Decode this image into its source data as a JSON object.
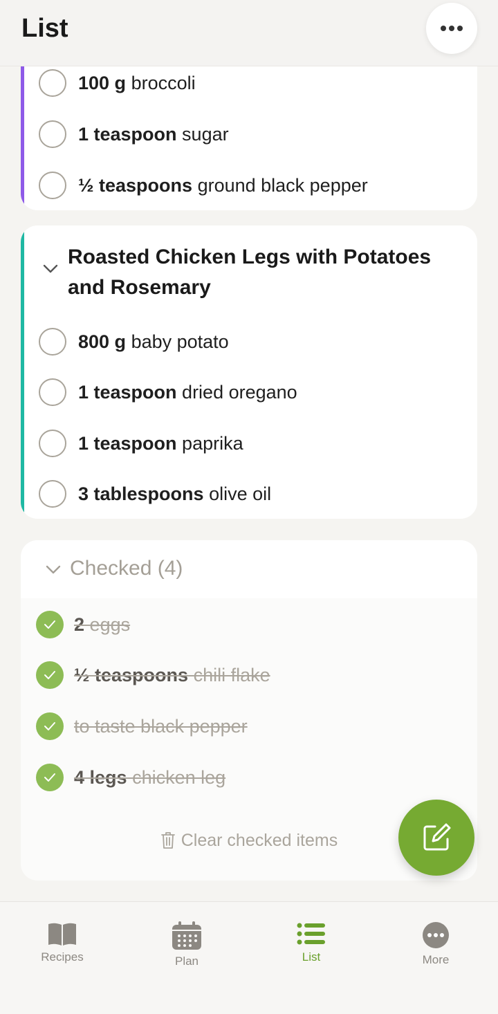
{
  "header": {
    "title": "List",
    "more_icon": "ellipsis-icon"
  },
  "card1": {
    "accent_color": "#8e5ae8",
    "items": [
      {
        "qty": "100 g",
        "name": "broccoli"
      },
      {
        "qty": "1 teaspoon",
        "name": "sugar"
      },
      {
        "qty": "½ teaspoons",
        "name": "ground black pepper"
      }
    ]
  },
  "card2": {
    "accent_color": "#1fb8a3",
    "recipe_title": "Roasted Chicken Legs with Potatoes and Rosemary",
    "items": [
      {
        "qty": "800 g",
        "name": "baby potato"
      },
      {
        "qty": "1 teaspoon",
        "name": "dried oregano"
      },
      {
        "qty": "1 teaspoon",
        "name": "paprika"
      },
      {
        "qty": "3 tablespoons",
        "name": "olive oil"
      }
    ]
  },
  "checked": {
    "label": "Checked (4)",
    "items": [
      {
        "qty": "2",
        "name": "eggs"
      },
      {
        "qty": "½ teaspoons",
        "name": "chili flake"
      },
      {
        "qty": "",
        "name": "to taste black pepper"
      },
      {
        "qty": "4 legs",
        "name": "chicken leg"
      }
    ],
    "clear_label": "Clear checked items"
  },
  "tabs": [
    {
      "label": "Recipes",
      "icon": "book-icon",
      "active": false
    },
    {
      "label": "Plan",
      "icon": "calendar-icon",
      "active": false
    },
    {
      "label": "List",
      "icon": "list-icon",
      "active": true
    },
    {
      "label": "More",
      "icon": "more-icon",
      "active": false
    }
  ],
  "colors": {
    "accent_green": "#76aa32",
    "check_green": "#8dbc55"
  }
}
